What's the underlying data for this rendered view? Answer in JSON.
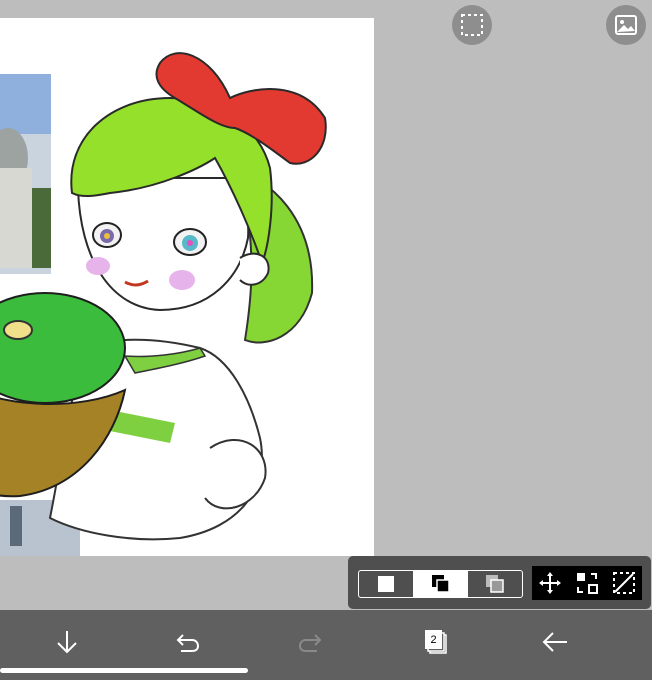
{
  "canvas": {
    "artwork": "drawing-canvas",
    "photo_reference": "photo-layer"
  },
  "top_actions": {
    "selection_icon": "selection-icon",
    "photo_icon": "photo-icon"
  },
  "transform_panel": {
    "blend_modes": [
      {
        "name": "normal",
        "selected": false
      },
      {
        "name": "overlay-front",
        "selected": true
      },
      {
        "name": "overlay-back",
        "selected": false
      }
    ],
    "tools": [
      "move-icon",
      "flip-icon",
      "transform-icon"
    ]
  },
  "bottom_bar": {
    "layers_count": "2",
    "icons": [
      "download-arrow-icon",
      "undo-icon",
      "redo-icon",
      "layers-icon",
      "back-arrow-icon"
    ]
  },
  "colors": {
    "background": "#bdbdbd",
    "toolbar": "#606060",
    "panel": "#4f4f4f"
  }
}
